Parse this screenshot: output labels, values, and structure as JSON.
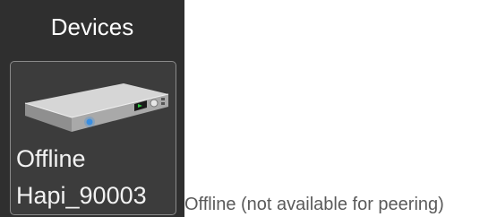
{
  "panel": {
    "title": "Devices",
    "background_color": "#2f2f2f"
  },
  "device": {
    "status": "Offline",
    "name": "Hapi_90003",
    "icon": "rack-unit-icon"
  },
  "legend": {
    "text": "Offline (not available for peering)"
  }
}
